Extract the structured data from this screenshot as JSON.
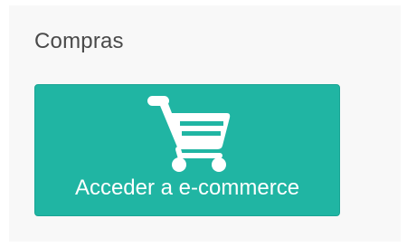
{
  "panel": {
    "title": "Compras",
    "button": {
      "label": "Acceder a e-commerce",
      "icon": "shopping-cart-icon",
      "color": "#20b5a3",
      "text_color": "#ffffff"
    }
  }
}
